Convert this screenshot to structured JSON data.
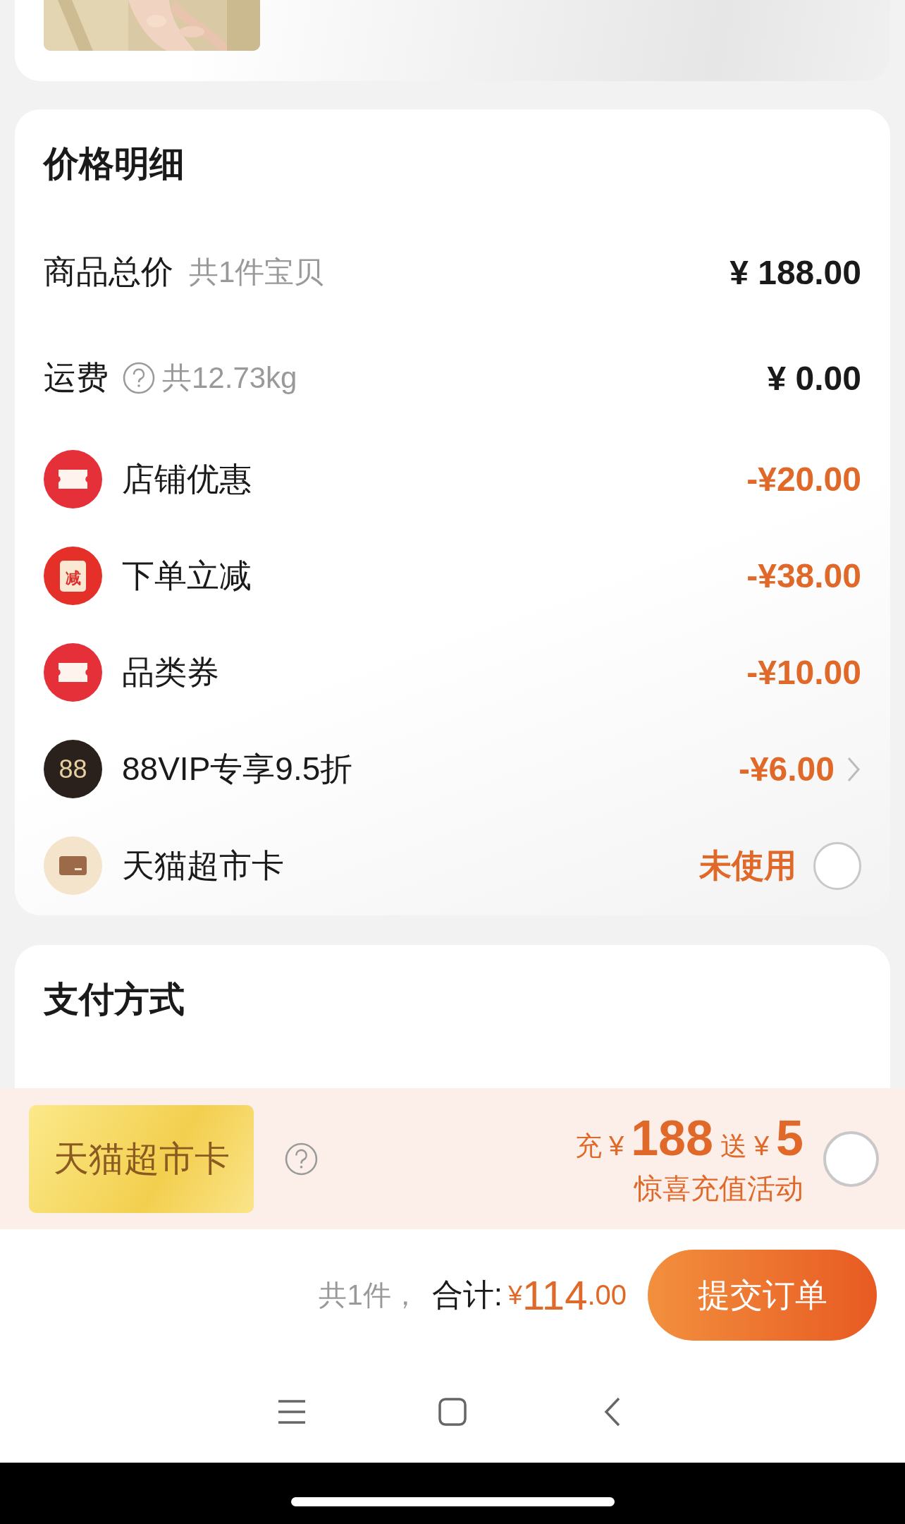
{
  "price_details": {
    "title": "价格明细",
    "rows": [
      {
        "kind": "plain",
        "label": "商品总价",
        "help_icon": false,
        "note": "共1件宝贝",
        "amount": "¥ 188.00"
      },
      {
        "kind": "plain",
        "label": "运费",
        "help_icon": true,
        "note": "共12.73kg",
        "amount": "¥ 0.00"
      },
      {
        "kind": "ticket",
        "label": "店铺优惠",
        "amount": "-¥20.00",
        "chevron": false
      },
      {
        "kind": "coupon",
        "icon_text": "减",
        "label": "下单立减",
        "amount": "-¥38.00",
        "chevron": false
      },
      {
        "kind": "ticket",
        "label": "品类券",
        "amount": "-¥10.00",
        "chevron": false
      },
      {
        "kind": "vip",
        "icon_text": "88",
        "label": "88VIP专享9.5折",
        "amount": "-¥6.00",
        "chevron": true
      },
      {
        "kind": "card",
        "label": "天猫超市卡",
        "status": "未使用",
        "selected": false
      }
    ]
  },
  "payment": {
    "title": "支付方式"
  },
  "promo_banner": {
    "card_label": "天猫超市卡",
    "recharge_label": "充",
    "recharge_currency": "¥",
    "recharge_amount": "188",
    "bonus_label": "送",
    "bonus_currency": "¥",
    "bonus_amount": "5",
    "caption": "惊喜充值活动",
    "selected": false
  },
  "footer": {
    "count": "共1件，",
    "total_label": "合计:",
    "currency": "¥",
    "total_int": "114",
    "total_dec": ".00",
    "submit": "提交订单"
  }
}
